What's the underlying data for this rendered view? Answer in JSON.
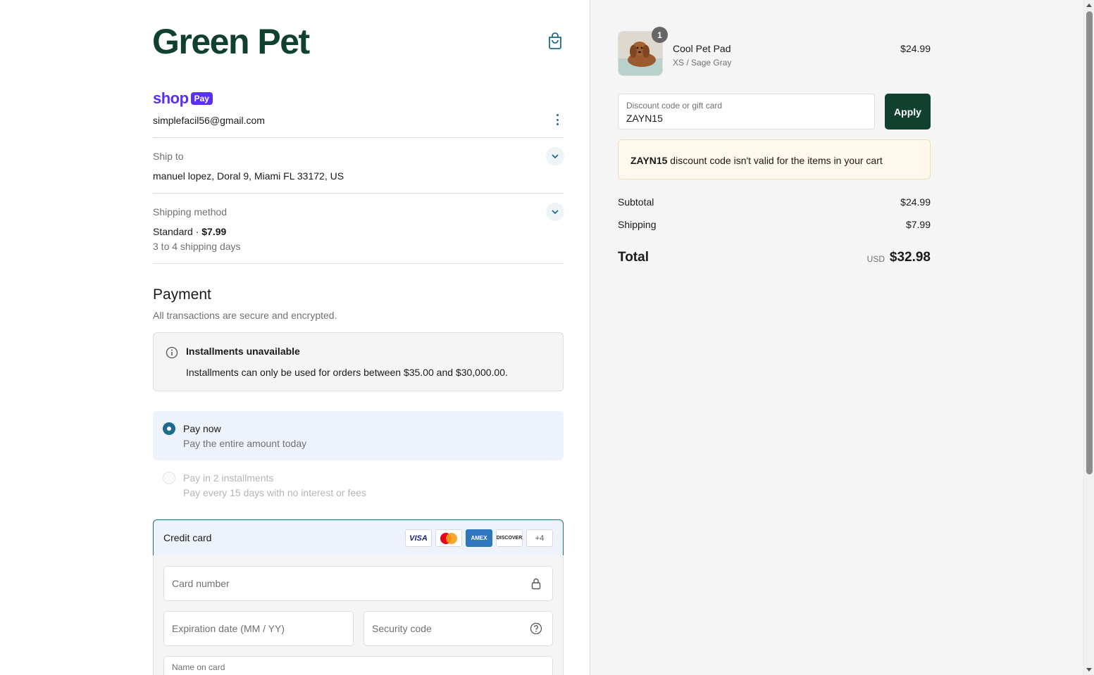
{
  "store": {
    "brand": "Green Pet"
  },
  "shop_pay": {
    "shop": "shop",
    "pay": "Pay",
    "email": "simplefacil56@gmail.com"
  },
  "ship_to": {
    "label": "Ship to",
    "value": "manuel lopez, Doral 9, Miami FL 33172, US"
  },
  "shipping_method": {
    "label": "Shipping method",
    "name": "Standard · ",
    "price": "$7.99",
    "detail": "3 to 4 shipping days"
  },
  "payment": {
    "title": "Payment",
    "subtitle": "All transactions are secure and encrypted.",
    "notice_title": "Installments unavailable",
    "notice_body": "Installments can only be used for orders between $35.00 and $30,000.00.",
    "options": [
      {
        "title": "Pay now",
        "subtitle": "Pay the entire amount today",
        "selected": true
      },
      {
        "title": "Pay in 2 installments",
        "subtitle": "Pay every 15 days with no interest or fees",
        "selected": false
      }
    ],
    "credit_card_label": "Credit card",
    "card_brands": [
      "VISA",
      "mastercard",
      "AMEX",
      "DISCOVER"
    ],
    "more_cards": "+4",
    "fields": {
      "card_number": "Card number",
      "expiration": "Expiration date (MM / YY)",
      "security_code": "Security code",
      "name_on_card": "Name on card"
    }
  },
  "order": {
    "product": {
      "name": "Cool Pet Pad",
      "variant": "XS / Sage Gray",
      "price": "$24.99",
      "quantity": "1"
    },
    "discount_label": "Discount code or gift card",
    "discount_value": "ZAYN15",
    "apply_label": "Apply",
    "warning_code": "ZAYN15",
    "warning_text": " discount code isn't valid for the items in your cart",
    "subtotal_label": "Subtotal",
    "subtotal_value": "$24.99",
    "shipping_label": "Shipping",
    "shipping_value": "$7.99",
    "total_label": "Total",
    "currency": "USD",
    "total_value": "$32.98"
  },
  "icons": {
    "bag": "shopping-bag-icon",
    "menu": "more-vertical-icon",
    "chevron": "chevron-down-icon",
    "info": "info-icon",
    "lock": "lock-icon",
    "help": "question-icon"
  },
  "colors": {
    "brand": "#10402e",
    "accent": "#1f6b8f",
    "shop_pay": "#5a31f4",
    "warning_bg": "#fff8ec"
  }
}
